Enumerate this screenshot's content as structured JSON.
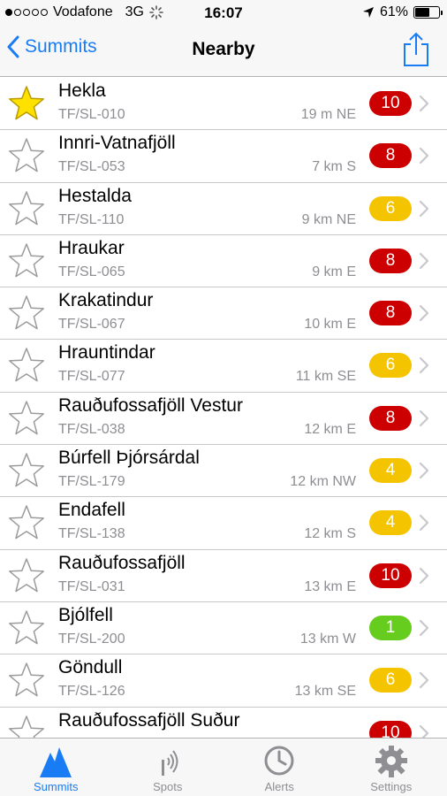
{
  "status_bar": {
    "carrier": "Vodafone",
    "network": "3G",
    "time": "16:07",
    "battery": "61%",
    "battery_level": 0.61,
    "signal_bars": 1
  },
  "nav": {
    "back_label": "Summits",
    "title": "Nearby",
    "share_icon": "share-icon"
  },
  "colors": {
    "accent": "#1a7cf5",
    "red": "#cc0000",
    "yellow": "#f5c400",
    "green": "#66cc1e",
    "star_fill": "#ffe100"
  },
  "summits": [
    {
      "name": "Hekla",
      "ref": "TF/SL-010",
      "distance": "19 m NE",
      "points": "10",
      "color": "red",
      "favorite": true
    },
    {
      "name": "Innri-Vatnafjöll",
      "ref": "TF/SL-053",
      "distance": "7 km S",
      "points": "8",
      "color": "red",
      "favorite": false
    },
    {
      "name": "Hestalda",
      "ref": "TF/SL-110",
      "distance": "9 km NE",
      "points": "6",
      "color": "yellow",
      "favorite": false
    },
    {
      "name": "Hraukar",
      "ref": "TF/SL-065",
      "distance": "9 km E",
      "points": "8",
      "color": "red",
      "favorite": false
    },
    {
      "name": "Krakatindur",
      "ref": "TF/SL-067",
      "distance": "10 km E",
      "points": "8",
      "color": "red",
      "favorite": false
    },
    {
      "name": "Hrauntindar",
      "ref": "TF/SL-077",
      "distance": "11 km SE",
      "points": "6",
      "color": "yellow",
      "favorite": false
    },
    {
      "name": "Rauðufossafjöll Vestur",
      "ref": "TF/SL-038",
      "distance": "12 km E",
      "points": "8",
      "color": "red",
      "favorite": false
    },
    {
      "name": "Búrfell Þjórsárdal",
      "ref": "TF/SL-179",
      "distance": "12 km NW",
      "points": "4",
      "color": "yellow",
      "favorite": false
    },
    {
      "name": "Endafell",
      "ref": "TF/SL-138",
      "distance": "12 km S",
      "points": "4",
      "color": "yellow",
      "favorite": false
    },
    {
      "name": "Rauðufossafjöll",
      "ref": "TF/SL-031",
      "distance": "13 km E",
      "points": "10",
      "color": "red",
      "favorite": false
    },
    {
      "name": "Bjólfell",
      "ref": "TF/SL-200",
      "distance": "13 km W",
      "points": "1",
      "color": "green",
      "favorite": false
    },
    {
      "name": "Göndull",
      "ref": "TF/SL-126",
      "distance": "13 km SE",
      "points": "6",
      "color": "yellow",
      "favorite": false
    },
    {
      "name": "Rauðufossafjöll Suður",
      "ref": "",
      "distance": "",
      "points": "10",
      "color": "red",
      "favorite": false
    }
  ],
  "tabs": [
    {
      "label": "Summits",
      "icon": "mountain-icon",
      "active": true
    },
    {
      "label": "Spots",
      "icon": "antenna-icon",
      "active": false
    },
    {
      "label": "Alerts",
      "icon": "clock-icon",
      "active": false
    },
    {
      "label": "Settings",
      "icon": "gear-icon",
      "active": false
    }
  ]
}
